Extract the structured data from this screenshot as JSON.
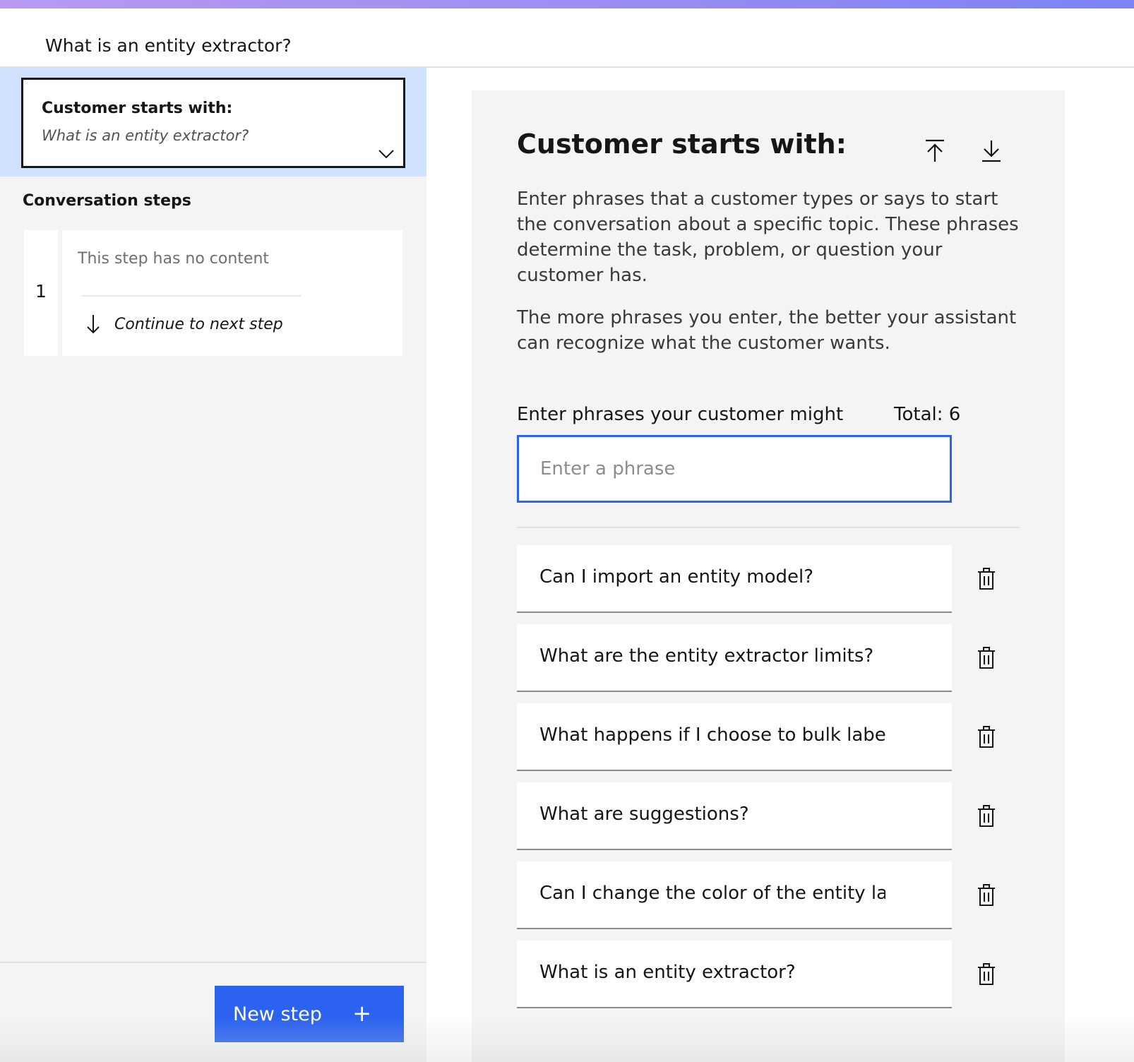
{
  "header": {
    "title_value": "What is an entity extractor?"
  },
  "sidebar": {
    "starts_card": {
      "label": "Customer starts with:",
      "value": "What is an entity extractor?"
    },
    "steps_heading": "Conversation steps",
    "steps": [
      {
        "number": "1",
        "empty_text": "This step has no content",
        "continue_text": "Continue to next step"
      }
    ],
    "new_step_label": "New step",
    "new_step_plus": "+"
  },
  "detail": {
    "title": "Customer starts with:",
    "description_1": "Enter phrases that a customer types or says to start the conversation about a specific topic. These phrases determine the task, problem, or question your customer has.",
    "description_2": "The more phrases you enter, the better your assistant can recognize what the customer wants.",
    "phrase_label": "Enter phrases your customer might",
    "total": "Total: 6",
    "phrase_placeholder": "Enter a phrase",
    "phrases": [
      "Can I import an entity model?",
      "What are the entity extractor limits?",
      "What happens if I choose to bulk label",
      "What are suggestions?",
      "Can I change the color of the entity lab",
      "What is an entity extractor?"
    ]
  },
  "colors": {
    "accent": "#2b63f0",
    "selected_bg": "#d0e2ff",
    "panel_bg": "#f4f4f4"
  },
  "icons": [
    "chevron-down-icon",
    "arrow-down-icon",
    "upload-icon",
    "download-icon",
    "trash-icon",
    "plus-icon"
  ]
}
